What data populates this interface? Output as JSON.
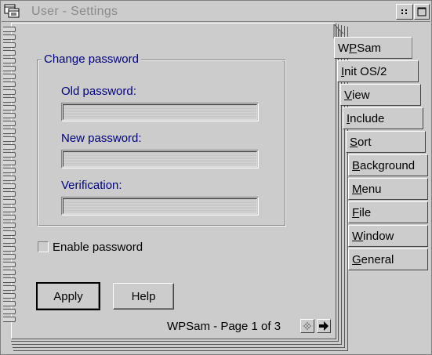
{
  "window": {
    "title": "User - Settings"
  },
  "group": {
    "title": "Change password",
    "fields": [
      {
        "label": "Old password:",
        "value": ""
      },
      {
        "label": "New password:",
        "value": ""
      },
      {
        "label": "Verification:",
        "value": ""
      }
    ]
  },
  "checkbox": {
    "label": "Enable password",
    "checked": false
  },
  "buttons": {
    "apply": "Apply",
    "help": "Help"
  },
  "pager": {
    "text": "WPSam - Page 1 of 3"
  },
  "tabs": [
    {
      "pre": "W",
      "mn": "P",
      "post": "Sam",
      "selected": true
    },
    {
      "pre": "",
      "mn": "I",
      "post": "nit OS/2",
      "selected": false
    },
    {
      "pre": "",
      "mn": "V",
      "post": "iew",
      "selected": false
    },
    {
      "pre": "",
      "mn": "I",
      "post": "nclude",
      "selected": false
    },
    {
      "pre": "",
      "mn": "S",
      "post": "ort",
      "selected": false
    },
    {
      "pre": "",
      "mn": "B",
      "post": "ackground",
      "selected": false
    },
    {
      "pre": "",
      "mn": "M",
      "post": "enu",
      "selected": false
    },
    {
      "pre": "",
      "mn": "F",
      "post": "ile",
      "selected": false
    },
    {
      "pre": "",
      "mn": "W",
      "post": "indow",
      "selected": false
    },
    {
      "pre": "",
      "mn": "G",
      "post": "eneral",
      "selected": false
    }
  ]
}
